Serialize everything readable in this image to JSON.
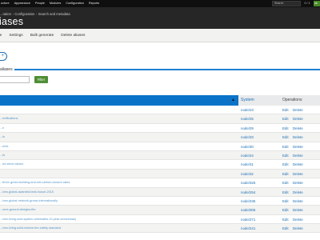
{
  "toolbar": {
    "menu": [
      "ucture",
      "Appearance",
      "People",
      "Modules",
      "Configuration",
      "Reports"
    ],
    "search_label": "Search",
    "search_count": "0 / 1",
    "go_label": "ok"
  },
  "breadcrumb": [
    "...ration",
    "Configuration",
    "Search and metadata"
  ],
  "page_title": "liases",
  "tabs": [
    "ne",
    "Settings",
    "Bulk generate",
    "Delete aliases"
  ],
  "add_button_label": "+",
  "filter": {
    "legend": "aliases",
    "input_value": "",
    "button_label": "Filter"
  },
  "table": {
    "sort_icon": "▲",
    "system_header": "System",
    "operations_header": "Operations",
    "rows": [
      {
        "alias": "",
        "system": "node/23",
        "edit": "Edit",
        "delete": "Delete"
      },
      {
        "alias": "...ertifications",
        "system": "node/25",
        "edit": "Edit",
        "delete": "Delete"
      },
      {
        "alias": "...n",
        "system": "node/29",
        "edit": "Edit",
        "delete": "Delete"
      },
      {
        "alias": "...ls",
        "system": "node/33",
        "edit": "Edit",
        "delete": "Delete"
      },
      {
        "alias": "...ents",
        "system": "node/30",
        "edit": "Edit",
        "delete": "Delete"
      },
      {
        "alias": "...ts",
        "system": "node/24",
        "edit": "Edit",
        "delete": "Delete"
      },
      {
        "alias": "...ed-stem-values",
        "system": "node/31",
        "edit": "Edit",
        "delete": "Delete"
      },
      {
        "alias": "",
        "system": "node/32",
        "edit": "Edit",
        "delete": "Delete"
      },
      {
        "alias": "...fit-for-green-building-and-net-carbon-closure-rates",
        "system": "node/326",
        "edit": "Edit",
        "delete": "Delete"
      },
      {
        "alias": "...ives-global-awarded-best-house-2015",
        "system": "node/254",
        "edit": "Edit",
        "delete": "Delete"
      },
      {
        "alias": "...ives-global-network-grows-internationally",
        "system": "node/236",
        "edit": "Edit",
        "delete": "Delete"
      },
      {
        "alias": "...ome-ground-designs-fire",
        "system": "node/306",
        "edit": "Edit",
        "delete": "Delete"
      },
      {
        "alias": "...ives-living-sold-system-celebrates-10-year-anniversary",
        "system": "node/271",
        "edit": "Edit",
        "delete": "Delete"
      },
      {
        "alias": "...ives-living-solid-restore-the-safety-standard",
        "system": "node/241",
        "edit": "Edit",
        "delete": "Delete"
      }
    ]
  }
}
